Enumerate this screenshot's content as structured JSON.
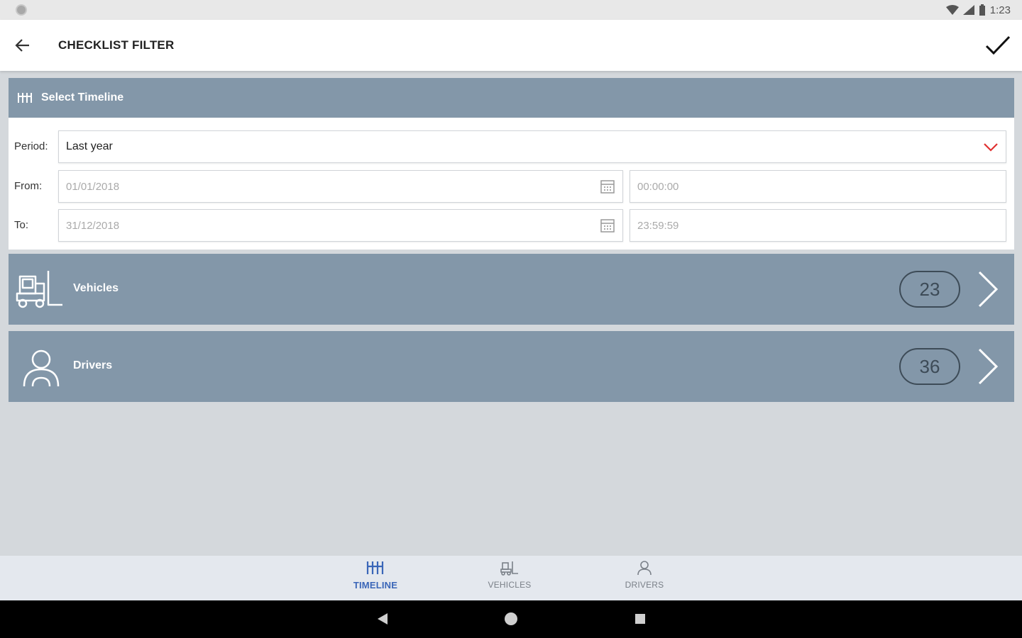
{
  "status_bar": {
    "time": "1:23"
  },
  "app_bar": {
    "title": "CHECKLIST FILTER"
  },
  "timeline": {
    "header": "Select Timeline",
    "period_label": "Period:",
    "period_value": "Last year",
    "from_label": "From:",
    "from_date": "01/01/2018",
    "from_time": "00:00:00",
    "to_label": "To:",
    "to_date": "31/12/2018",
    "to_time": "23:59:59"
  },
  "vehicles": {
    "label": "Vehicles",
    "count": "23"
  },
  "drivers": {
    "label": "Drivers",
    "count": "36"
  },
  "bottom_nav": {
    "items": [
      {
        "label": "TIMELINE",
        "icon": "timeline-icon",
        "active": true
      },
      {
        "label": "VEHICLES",
        "icon": "forklift-icon",
        "active": false
      },
      {
        "label": "DRIVERS",
        "icon": "person-icon",
        "active": false
      }
    ]
  },
  "colors": {
    "section_bg": "#8397a9",
    "accent": "#3a66b8",
    "chevron_red": "#e03030"
  }
}
